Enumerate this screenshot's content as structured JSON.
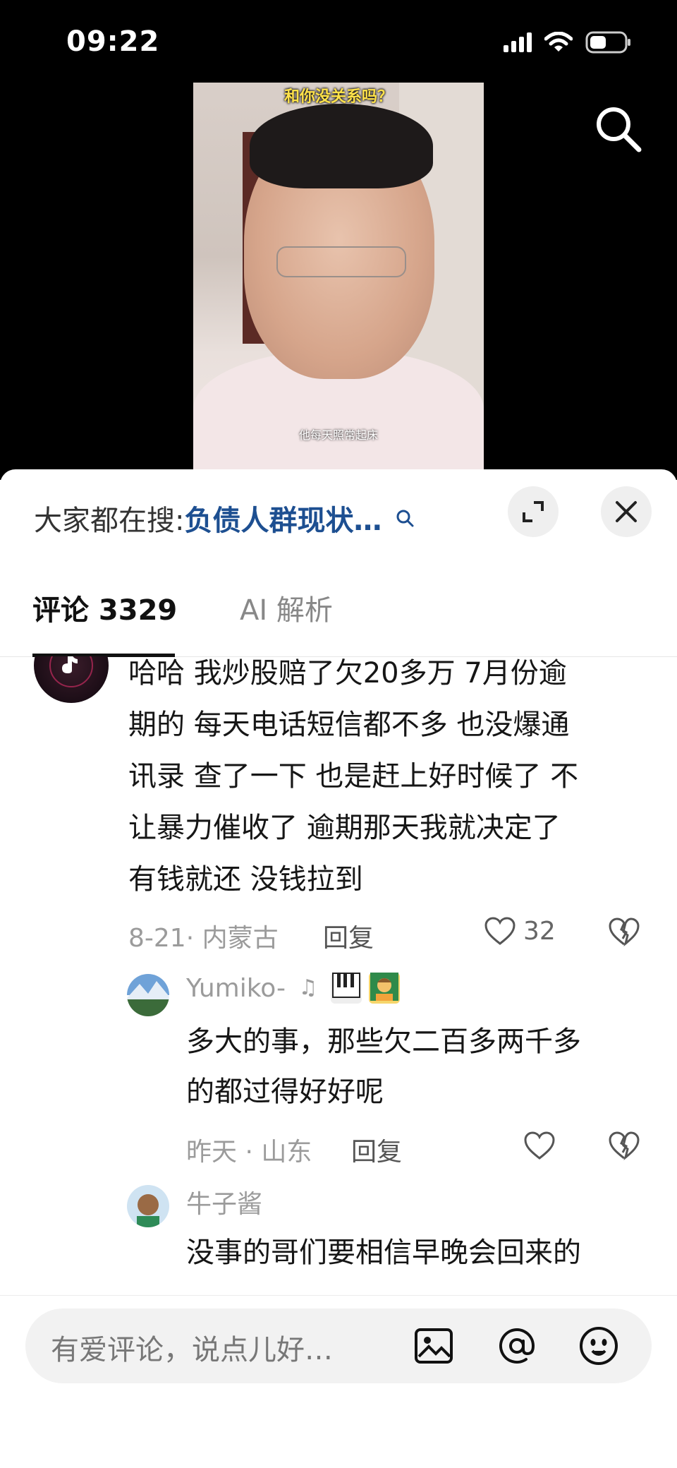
{
  "status_bar": {
    "time": "09:22"
  },
  "video": {
    "caption_top": "和你没关系吗？",
    "caption_bottom": "他每天照常起床"
  },
  "hot_search": {
    "prefix": "大家都在搜:",
    "keyword": "负债人群现状…"
  },
  "tabs": [
    {
      "label": "评论 3329"
    },
    {
      "label": "AI 解析"
    }
  ],
  "comments": {
    "main": {
      "lines": [
        "哈哈  我炒股赔了欠20多万  7月份逾",
        "期的  每天电话短信都不多  也没爆通",
        "讯录  查了一下  也是赶上好时候了  不",
        "让暴力催收了  逾期那天我就决定了",
        "有钱就还 没钱拉到"
      ],
      "meta": "8-21· 内蒙古",
      "reply_label": "回复",
      "likes": "32"
    },
    "replies": [
      {
        "name": "Yumiko-",
        "lines": [
          "多大的事，那些欠二百多两千多",
          "的都过得好好呢"
        ],
        "meta": "昨天 · 山东",
        "reply_label": "回复"
      },
      {
        "name": "牛子酱",
        "lines": [
          "没事的哥们要相信早晚会回来的"
        ]
      }
    ]
  },
  "input_bar": {
    "placeholder": "有爱评论，说点儿好…"
  },
  "colors": {
    "keyword": "#1d4f91",
    "caption": "#ffe24a"
  }
}
